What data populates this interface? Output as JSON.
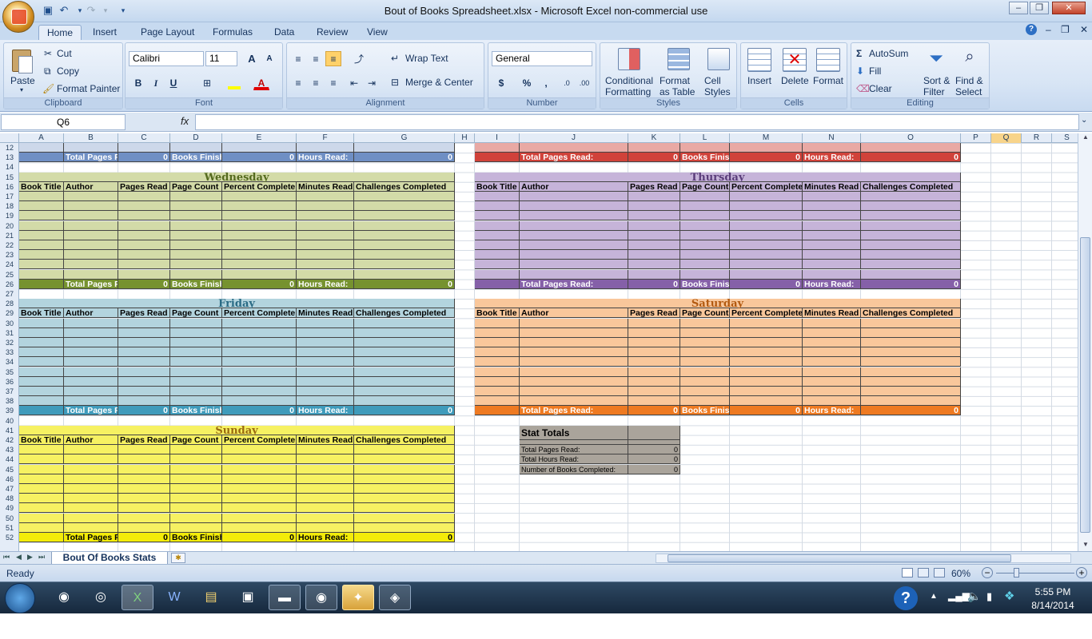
{
  "window": {
    "title": "Bout of Books Spreadsheet.xlsx - Microsoft Excel non-commercial use",
    "minimize": "–",
    "maximize": "❐",
    "close": "✕",
    "ribbon_min": "–",
    "ribbon_restore": "❐",
    "ribbon_close": "✕",
    "help": "?"
  },
  "tabs": [
    "Home",
    "Insert",
    "Page Layout",
    "Formulas",
    "Data",
    "Review",
    "View"
  ],
  "ribbon": {
    "clipboard": {
      "label": "Clipboard",
      "paste": "Paste",
      "cut": "Cut",
      "copy": "Copy",
      "format_painter": "Format Painter"
    },
    "font": {
      "label": "Font",
      "name": "Calibri",
      "size": "11",
      "bold": "B",
      "italic": "I",
      "underline": "U",
      "grow": "A",
      "shrink": "A"
    },
    "alignment": {
      "label": "Alignment",
      "wrap": "Wrap Text",
      "merge": "Merge & Center"
    },
    "number": {
      "label": "Number",
      "format": "General",
      "currency": "$",
      "percent": "%",
      "comma": ",",
      "inc_dec": ".0",
      "dec_dec": ".00"
    },
    "styles": {
      "label": "Styles",
      "conditional": "Conditional",
      "conditional2": "Formatting",
      "as_table": "Format",
      "as_table2": "as Table",
      "cell_styles": "Cell",
      "cell_styles2": "Styles"
    },
    "cells": {
      "label": "Cells",
      "insert": "Insert",
      "delete": "Delete",
      "format": "Format"
    },
    "editing": {
      "label": "Editing",
      "autosum": "AutoSum",
      "fill": "Fill",
      "clear": "Clear",
      "sort": "Sort &",
      "sort2": "Filter",
      "find": "Find &",
      "find2": "Select"
    }
  },
  "formula_bar": {
    "name_box": "Q6",
    "fx": "fx",
    "formula": ""
  },
  "columns": [
    "A",
    "B",
    "C",
    "D",
    "E",
    "F",
    "G",
    "H",
    "I",
    "J",
    "K",
    "L",
    "M",
    "N",
    "O",
    "P",
    "Q",
    "R",
    "S"
  ],
  "rows": [
    "12",
    "13",
    "14",
    "15",
    "16",
    "17",
    "18",
    "19",
    "20",
    "21",
    "22",
    "23",
    "24",
    "25",
    "26",
    "27",
    "28",
    "29",
    "30",
    "31",
    "32",
    "33",
    "34",
    "35",
    "36",
    "37",
    "38",
    "39",
    "40",
    "41",
    "42",
    "43",
    "44",
    "45",
    "46",
    "47",
    "48",
    "49",
    "50",
    "51",
    "52"
  ],
  "headers": [
    "Book Title",
    "Author",
    "Pages Read",
    "Page Count",
    "Percent Complete",
    "Minutes Read",
    "Challenges Completed"
  ],
  "totals_row": {
    "pages": "Total Pages Read:",
    "pages_val": "0",
    "books": "Books Finished:",
    "books_val": "0",
    "hours": "Hours Read:",
    "hours_val": "0"
  },
  "days": {
    "wednesday": "Wednesday",
    "thursday": "Thursday",
    "friday": "Friday",
    "saturday": "Saturday",
    "sunday": "Sunday"
  },
  "stats": {
    "title": "Stat Totals",
    "rows": [
      {
        "label": "Total Pages Read:",
        "value": "0"
      },
      {
        "label": "Total Hours Read:",
        "value": "0"
      },
      {
        "label": "Number of Books Completed:",
        "value": "0"
      }
    ]
  },
  "sheet_tab": "Bout Of Books Stats",
  "status": {
    "ready": "Ready",
    "zoom": "60%"
  },
  "taskbar": {
    "time": "5:55 PM",
    "date": "8/14/2014"
  },
  "colors": {
    "wed": "#d3dba8",
    "wed_bar": "#76922f",
    "thu": "#c6b4d9",
    "thu_bar": "#8560a8",
    "fri": "#b3d4de",
    "fri_bar": "#3f9bbb",
    "sat": "#f9c79b",
    "sat_bar": "#ee7a22",
    "sun": "#f6f162",
    "sun_bar": "#f3ec09",
    "top_left_bar": "#6f8fc4",
    "top_right_bar": "#d0423a",
    "stats": "#aaa49b"
  }
}
